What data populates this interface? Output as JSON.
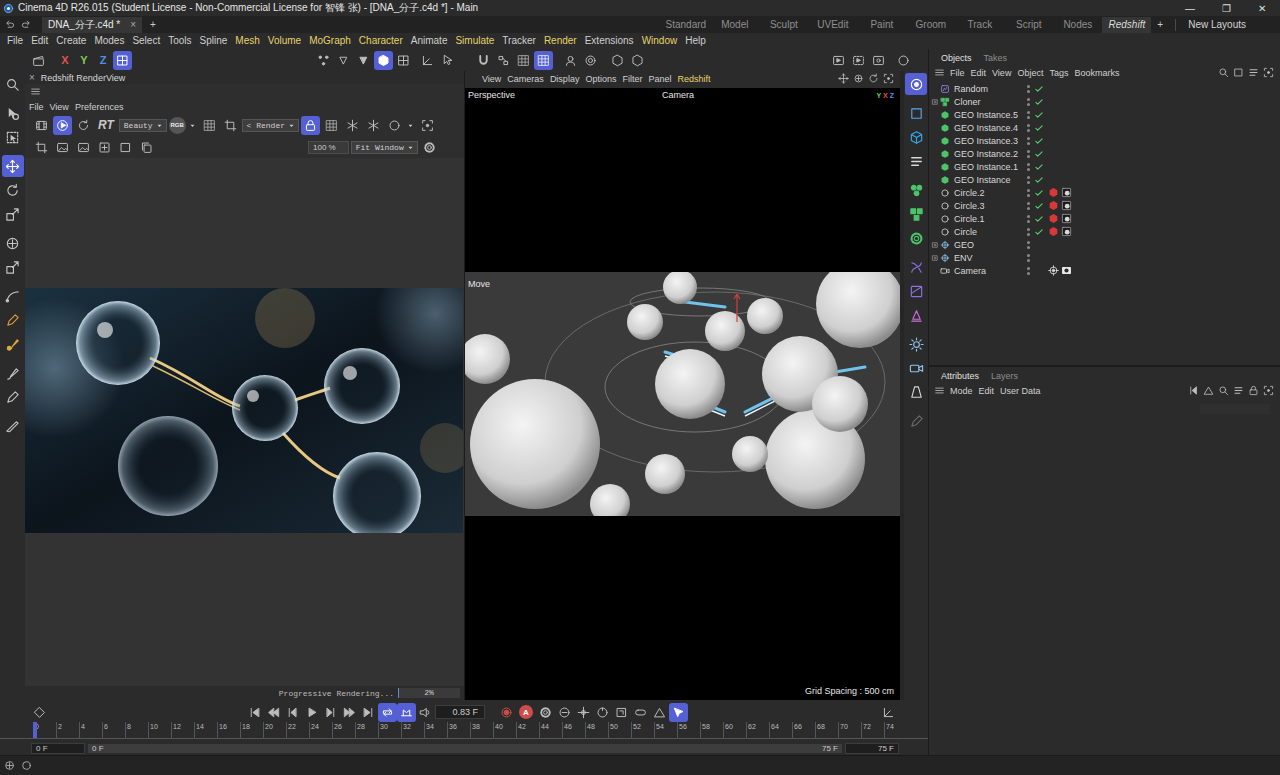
{
  "window": {
    "title": "Cinema 4D R26.015 (Student License - Non-Commercial License for 智锋 张) - [DNA_分子.c4d *] - Main",
    "controls": [
      "—",
      "❐",
      "✕"
    ]
  },
  "document_tabs": [
    {
      "label": "DNA_分子.c4d *",
      "close": "×",
      "selected": true
    }
  ],
  "new_tab": "+",
  "layouts": [
    {
      "label": "Standard",
      "selected": false
    },
    {
      "label": "Model",
      "selected": false
    },
    {
      "label": "Sculpt",
      "selected": false
    },
    {
      "label": "UVEdit",
      "selected": false
    },
    {
      "label": "Paint",
      "selected": false
    },
    {
      "label": "Groom",
      "selected": false
    },
    {
      "label": "Track",
      "selected": false
    },
    {
      "label": "Script",
      "selected": false
    },
    {
      "label": "Nodes",
      "selected": false
    },
    {
      "label": "Redshift",
      "selected": true
    }
  ],
  "add_layout": "+",
  "new_layouts": "New Layouts",
  "menu": [
    {
      "label": "File",
      "highlighted": false
    },
    {
      "label": "Edit",
      "highlighted": false
    },
    {
      "label": "Create",
      "highlighted": false
    },
    {
      "label": "Modes",
      "highlighted": false
    },
    {
      "label": "Select",
      "highlighted": false
    },
    {
      "label": "Tools",
      "highlighted": false
    },
    {
      "label": "Spline",
      "highlighted": false
    },
    {
      "label": "Mesh",
      "highlighted": true
    },
    {
      "label": "Volume",
      "highlighted": true
    },
    {
      "label": "MoGraph",
      "highlighted": true
    },
    {
      "label": "Character",
      "highlighted": true
    },
    {
      "label": "Animate",
      "highlighted": false
    },
    {
      "label": "Simulate",
      "highlighted": true
    },
    {
      "label": "Tracker",
      "highlighted": false
    },
    {
      "label": "Render",
      "highlighted": true
    },
    {
      "label": "Extensions",
      "highlighted": false
    },
    {
      "label": "Window",
      "highlighted": true
    },
    {
      "label": "Help",
      "highlighted": false
    }
  ],
  "toolbar": {
    "start": [
      {
        "kind": "clapper",
        "selected": false
      }
    ],
    "axes": [
      {
        "label": "X",
        "color": "#e05050"
      },
      {
        "label": "Y",
        "color": "#7ad04e"
      },
      {
        "label": "Z",
        "color": "#4f8ff0"
      }
    ],
    "coordinate_system": {
      "selected": true
    },
    "groups": [
      [
        {
          "kind": "points",
          "selected": false
        },
        {
          "kind": "edges",
          "selected": false
        },
        {
          "kind": "polygons",
          "selected": false
        },
        {
          "kind": "model",
          "selected": true
        },
        {
          "kind": "uv",
          "selected": false
        }
      ],
      [
        {
          "kind": "axis-mode",
          "selected": false
        },
        {
          "kind": "tweak",
          "selected": false
        }
      ],
      [
        {
          "kind": "magnet",
          "selected": false
        },
        {
          "kind": "snap",
          "selected": false
        },
        {
          "kind": "grid",
          "selected": false
        },
        {
          "kind": "grid",
          "selected": true
        }
      ],
      [
        {
          "kind": "solo",
          "selected": false
        },
        {
          "kind": "target",
          "selected": false
        }
      ],
      [
        {
          "kind": "hexagon",
          "selected": false
        },
        {
          "kind": "hexagon",
          "selected": false
        }
      ],
      [
        {
          "kind": "render-view",
          "selected": false
        },
        {
          "kind": "render-region",
          "selected": false
        },
        {
          "kind": "render-settings",
          "selected": false
        }
      ],
      [
        {
          "kind": "ring",
          "selected": false
        }
      ]
    ]
  },
  "left_tools": [
    [
      {
        "kind": "search",
        "selected": false,
        "color": "#c4c4c4"
      }
    ],
    [
      {
        "kind": "live-select",
        "selected": false,
        "color": "#c4c4c4"
      },
      {
        "kind": "rect-select",
        "selected": false,
        "color": "#c4c4c4"
      }
    ],
    [
      {
        "kind": "move",
        "selected": true,
        "color": "#ffffff"
      },
      {
        "kind": "rotate",
        "selected": false,
        "color": "#c4c4c4"
      },
      {
        "kind": "scale",
        "selected": false,
        "color": "#c4c4c4"
      }
    ],
    [
      {
        "kind": "transform",
        "selected": false,
        "color": "#c4c4c4"
      },
      {
        "kind": "scale",
        "selected": false,
        "color": "#c4c4c4"
      }
    ],
    [
      {
        "kind": "curve",
        "selected": false,
        "color": "#c4c4c4"
      },
      {
        "kind": "pen",
        "selected": false,
        "color": "#e39a3b"
      },
      {
        "kind": "paint",
        "selected": false,
        "color": "#e3a83b"
      }
    ],
    [
      {
        "kind": "brush",
        "selected": false,
        "color": "#c4c4c4"
      },
      {
        "kind": "pen",
        "selected": false,
        "color": "#c4c4c4"
      }
    ],
    [
      {
        "kind": "knife",
        "selected": false,
        "color": "#c4c4c4"
      }
    ]
  ],
  "right_tools": [
    [
      {
        "kind": "objects-mgr",
        "selected": true,
        "color": "#ffffff"
      }
    ],
    [
      {
        "kind": "square",
        "selected": false,
        "color": "#5aa6ee"
      },
      {
        "kind": "cube",
        "selected": false,
        "color": "#35a9ec"
      },
      {
        "kind": "lines",
        "selected": false,
        "color": "#d8d8d8"
      }
    ],
    [
      {
        "kind": "mograph",
        "selected": false,
        "color": "#4cc46a"
      },
      {
        "kind": "cloner",
        "selected": false,
        "color": "#4cc46a"
      },
      {
        "kind": "gear",
        "selected": false,
        "color": "#4cc46a"
      }
    ],
    [
      {
        "kind": "deformer",
        "selected": false,
        "color": "#8c72e0"
      },
      {
        "kind": "field",
        "selected": false,
        "color": "#8c72e0"
      },
      {
        "kind": "sculpt",
        "selected": false,
        "color": "#c870dc"
      }
    ],
    [
      {
        "kind": "light",
        "selected": false,
        "color": "#8fc4ee"
      },
      {
        "kind": "camera",
        "selected": false,
        "color": "#8fc4ee"
      },
      {
        "kind": "spot",
        "selected": false,
        "color": "#d8d8d8"
      }
    ],
    [
      {
        "kind": "pen",
        "selected": false,
        "color": "#6a6a6a"
      }
    ]
  ],
  "render_view": {
    "close": "×",
    "title": "Redshift RenderView",
    "menu": [
      "File",
      "View",
      "Preferences"
    ],
    "row1": [
      {
        "kind": "film",
        "text": "",
        "selected": false
      },
      {
        "kind": "play-circle",
        "text": "",
        "selected": true
      },
      {
        "kind": "refresh",
        "text": "",
        "selected": false
      },
      {
        "kind": "label",
        "text": "RT",
        "selected": false
      },
      {
        "kind": "dropdown",
        "text": "Beauty",
        "selected": false
      },
      {
        "kind": "badge",
        "text": "RGB",
        "selected": false
      },
      {
        "kind": "caret",
        "text": "",
        "selected": false
      },
      {
        "kind": "grid",
        "text": "",
        "selected": false
      },
      {
        "kind": "crop",
        "text": "",
        "selected": false
      },
      {
        "kind": "dropdown",
        "text": "< Render",
        "selected": false
      },
      {
        "kind": "lock",
        "text": "",
        "selected": true
      },
      {
        "kind": "grid",
        "text": "",
        "selected": false
      },
      {
        "kind": "snow",
        "text": "",
        "selected": false
      },
      {
        "kind": "snow",
        "text": "",
        "selected": false
      },
      {
        "kind": "ring",
        "text": "",
        "selected": false
      },
      {
        "kind": "caret",
        "text": "",
        "selected": false
      },
      {
        "kind": "frame",
        "text": "",
        "selected": false
      }
    ],
    "row2": [
      {
        "kind": "crop",
        "text": "",
        "selected": false
      },
      {
        "kind": "image",
        "text": "",
        "selected": false
      },
      {
        "kind": "image",
        "text": "",
        "selected": false
      },
      {
        "kind": "plus-box",
        "text": "",
        "selected": false
      },
      {
        "kind": "square",
        "text": "",
        "selected": false
      },
      {
        "kind": "copy",
        "text": "",
        "selected": false
      },
      {
        "kind": "field",
        "text": "100 %",
        "selected": false
      },
      {
        "kind": "dropdown",
        "text": "Fit Window",
        "selected": false
      },
      {
        "kind": "gear",
        "text": "",
        "selected": false
      }
    ],
    "status": "Progressive Rendering...",
    "progress_text": "2%",
    "progress": 0.02
  },
  "viewport": {
    "menu": [
      {
        "label": "View",
        "highlighted": false
      },
      {
        "label": "Cameras",
        "highlighted": false
      },
      {
        "label": "Display",
        "highlighted": false
      },
      {
        "label": "Options",
        "highlighted": false
      },
      {
        "label": "Filter",
        "highlighted": false
      },
      {
        "label": "Panel",
        "highlighted": false
      },
      {
        "label": "Redshift",
        "highlighted": true
      }
    ],
    "name": "Perspective",
    "camera": "Camera",
    "tool": "Move",
    "grid": "Grid Spacing : 500 cm",
    "axes": [
      {
        "label": "Y",
        "color": "#7ad04e"
      },
      {
        "label": "X",
        "color": "#e05050"
      },
      {
        "label": "Z",
        "color": "#4f8ff0"
      }
    ]
  },
  "objects_panel": {
    "tabs": [
      {
        "label": "Objects",
        "selected": true
      },
      {
        "label": "Takes",
        "selected": false
      }
    ],
    "menu": [
      "File",
      "Edit",
      "View",
      "Object",
      "Tags",
      "Bookmarks"
    ],
    "items": [
      {
        "name": "Random",
        "kind": "effector",
        "expandable": false,
        "checked": true,
        "tags": []
      },
      {
        "name": "Cloner",
        "kind": "cloner",
        "expandable": true,
        "checked": true,
        "tags": []
      },
      {
        "name": "GEO Instance.5",
        "kind": "instance",
        "expandable": false,
        "checked": true,
        "tags": []
      },
      {
        "name": "GEO Instance.4",
        "kind": "instance",
        "expandable": false,
        "checked": true,
        "tags": []
      },
      {
        "name": "GEO Instance.3",
        "kind": "instance",
        "expandable": false,
        "checked": true,
        "tags": []
      },
      {
        "name": "GEO Instance.2",
        "kind": "instance",
        "expandable": false,
        "checked": true,
        "tags": []
      },
      {
        "name": "GEO Instance.1",
        "kind": "instance",
        "expandable": false,
        "checked": true,
        "tags": []
      },
      {
        "name": "GEO Instance",
        "kind": "instance",
        "expandable": false,
        "checked": true,
        "tags": []
      },
      {
        "name": "Circle.2",
        "kind": "spline",
        "expandable": false,
        "checked": true,
        "tags": [
          "redshift-tag",
          "material-tag"
        ]
      },
      {
        "name": "Circle.3",
        "kind": "spline",
        "expandable": false,
        "checked": true,
        "tags": [
          "redshift-tag",
          "material-tag"
        ]
      },
      {
        "name": "Circle.1",
        "kind": "spline",
        "expandable": false,
        "checked": true,
        "tags": [
          "redshift-tag",
          "material-tag"
        ]
      },
      {
        "name": "Circle",
        "kind": "spline",
        "expandable": false,
        "checked": true,
        "tags": [
          "redshift-tag",
          "material-tag"
        ]
      },
      {
        "name": "GEO",
        "kind": "null",
        "expandable": true,
        "checked": false,
        "tags": []
      },
      {
        "name": "ENV",
        "kind": "null",
        "expandable": true,
        "checked": false,
        "tags": []
      },
      {
        "name": "Camera",
        "kind": "camera",
        "expandable": false,
        "checked": false,
        "tags": [
          "target-tag",
          "camera-tag"
        ]
      }
    ]
  },
  "attributes_panel": {
    "tabs": [
      {
        "label": "Attributes",
        "selected": true
      },
      {
        "label": "Layers",
        "selected": false
      }
    ],
    "menu": [
      "Mode",
      "Edit",
      "User Data"
    ]
  },
  "timeline": {
    "transport_left": [
      {
        "kind": "skip-start",
        "selected": false
      },
      {
        "kind": "prev-key",
        "selected": false
      },
      {
        "kind": "prev-frame",
        "selected": false
      },
      {
        "kind": "play",
        "selected": false
      },
      {
        "kind": "next-frame",
        "selected": false
      },
      {
        "kind": "next-key",
        "selected": false
      },
      {
        "kind": "skip-end",
        "selected": false
      },
      {
        "kind": "loop",
        "selected": true
      },
      {
        "kind": "range",
        "selected": true
      },
      {
        "kind": "sound",
        "selected": false
      }
    ],
    "current_frame": "0.83 F",
    "record": {
      "label": "A"
    },
    "transport_right": [
      {
        "kind": "gear",
        "selected": false
      },
      {
        "kind": "motion",
        "selected": false
      },
      {
        "kind": "key-pos",
        "selected": false
      },
      {
        "kind": "key-rot",
        "selected": false
      },
      {
        "kind": "key-scale",
        "selected": false
      },
      {
        "kind": "key-param",
        "selected": false
      },
      {
        "kind": "key-pla",
        "selected": false
      },
      {
        "kind": "key-point",
        "selected": true
      }
    ],
    "ticks": [
      "0",
      "2",
      "4",
      "6",
      "8",
      "10",
      "12",
      "14",
      "16",
      "18",
      "20",
      "22",
      "24",
      "26",
      "28",
      "30",
      "32",
      "34",
      "36",
      "38",
      "40",
      "42",
      "44",
      "46",
      "48",
      "50",
      "52",
      "54",
      "56",
      "58",
      "60",
      "62",
      "64",
      "66",
      "68",
      "70",
      "72",
      "74"
    ],
    "playhead": 0,
    "start_field": "0 F",
    "range_start": "0 F",
    "range_end": "75 F",
    "end_field": "75 F"
  }
}
